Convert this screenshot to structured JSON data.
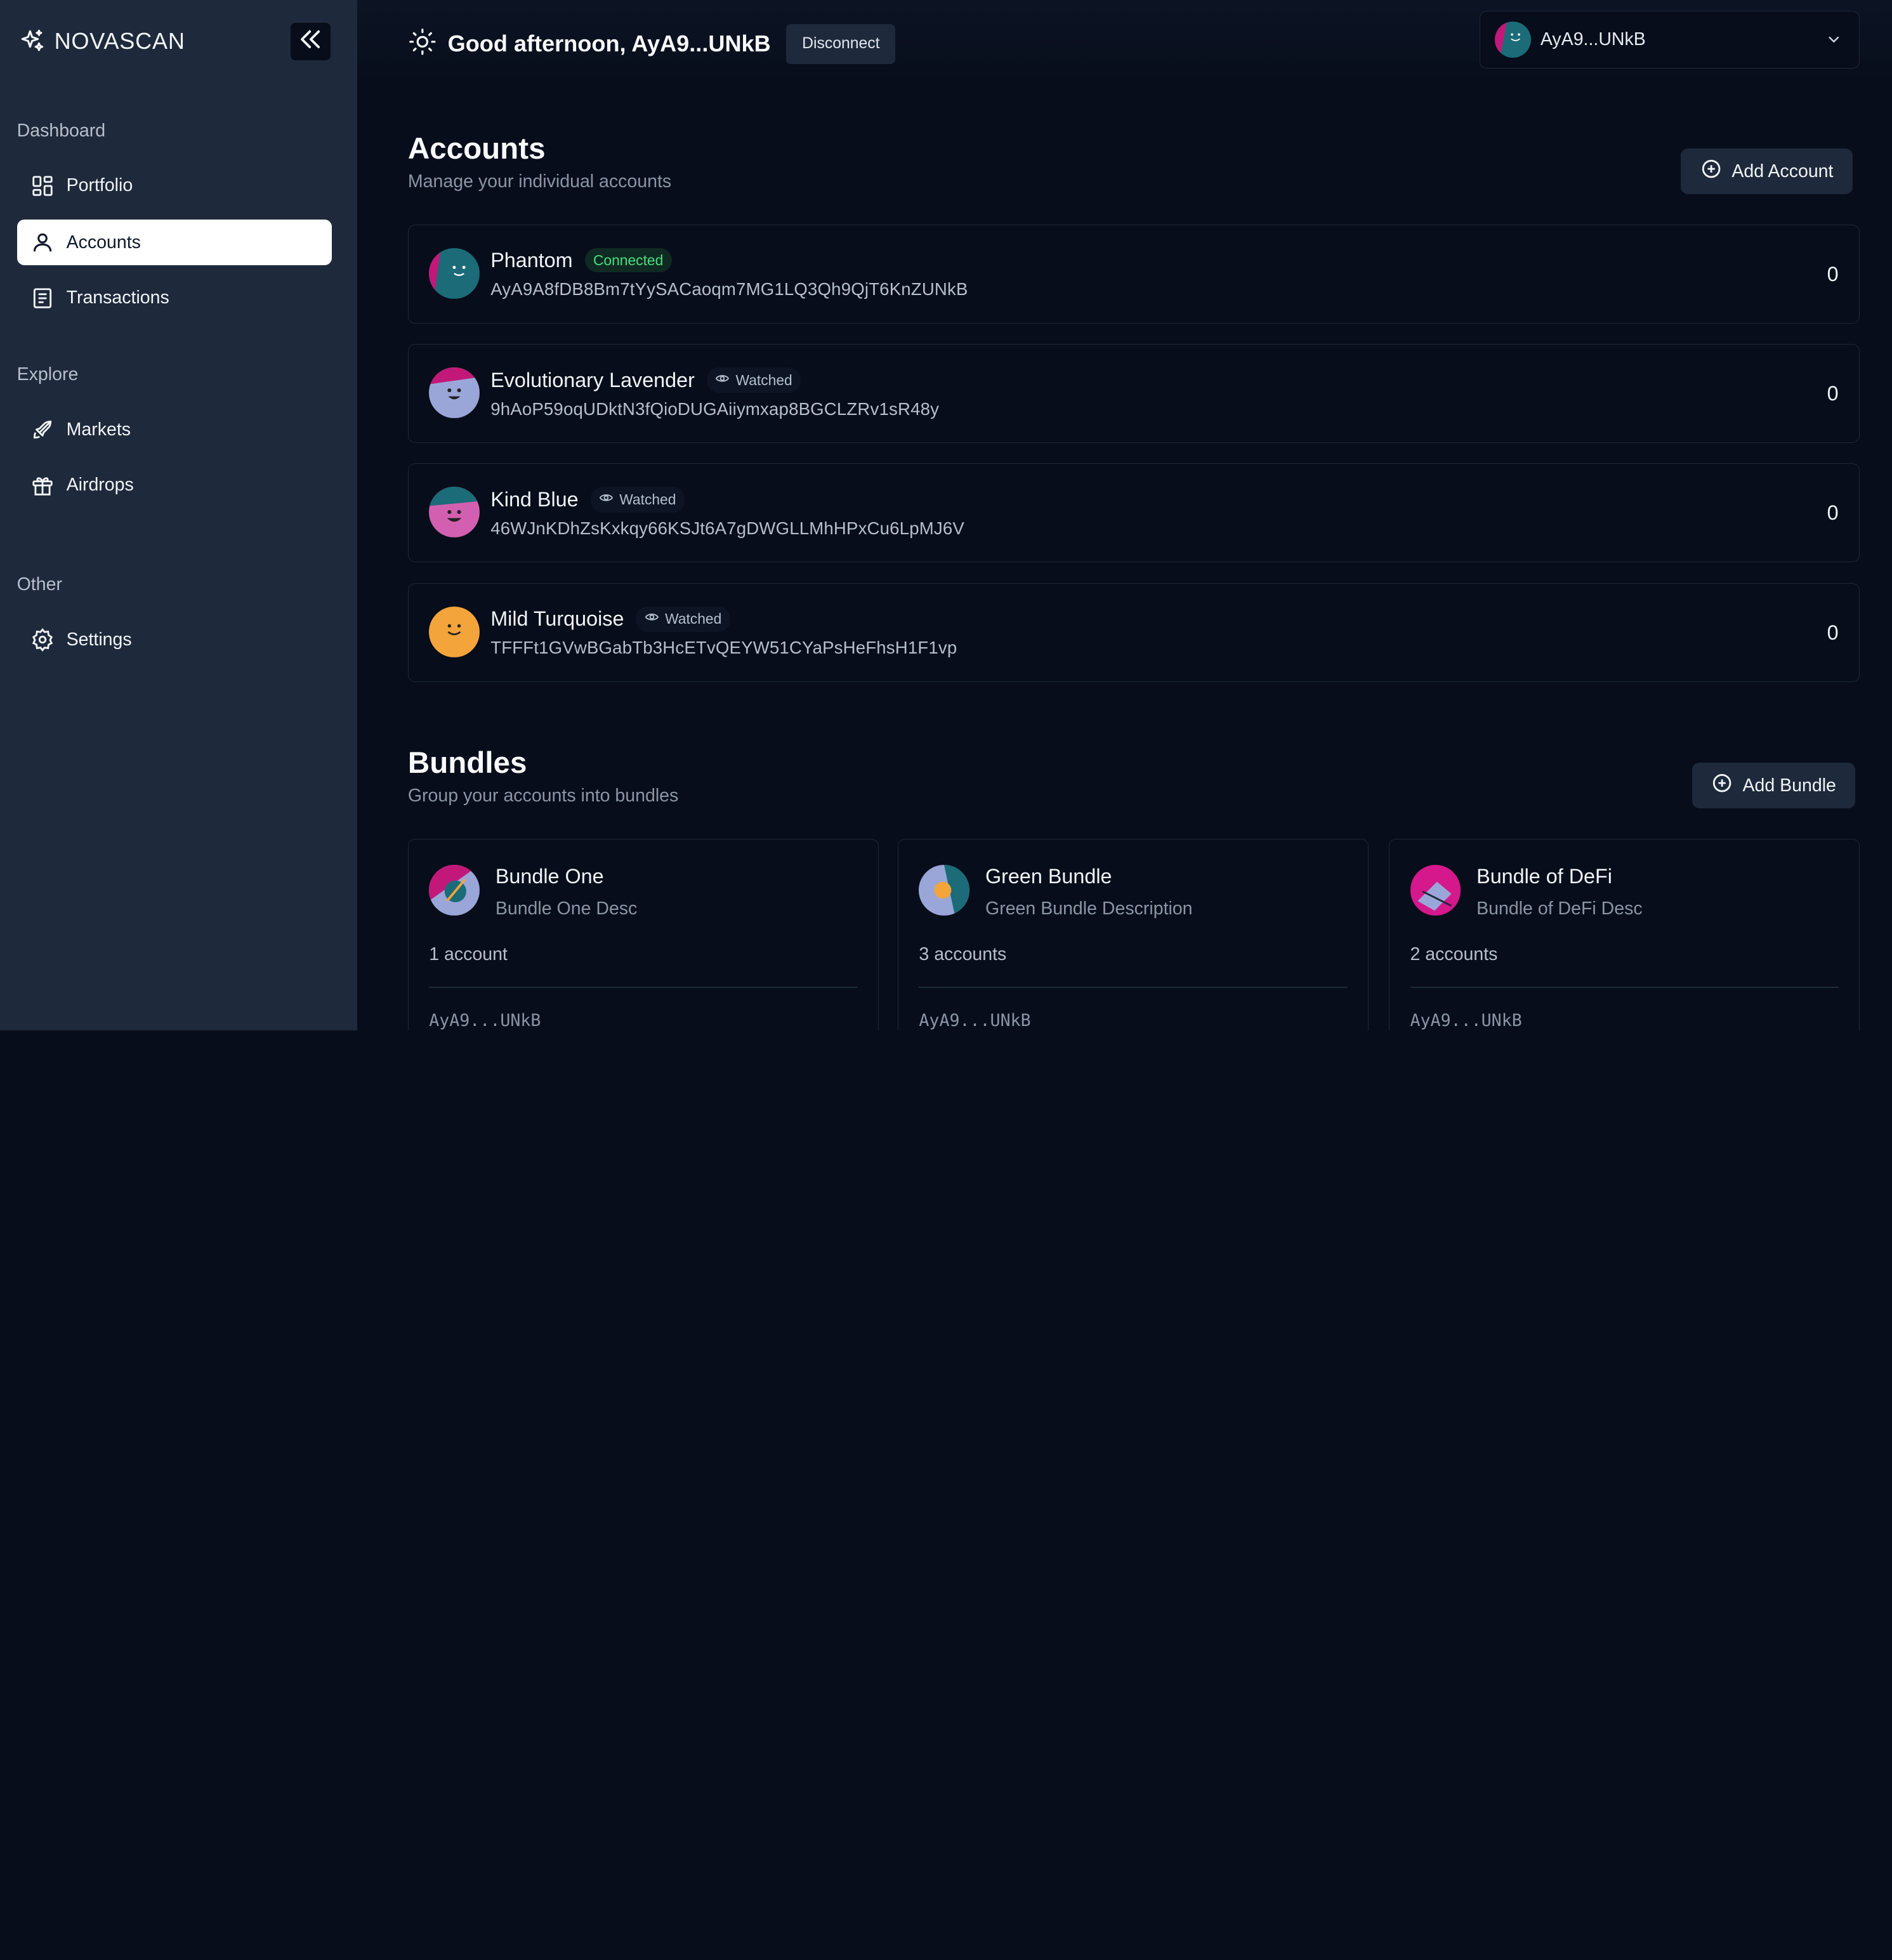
{
  "app": {
    "brand": "NOVASCAN"
  },
  "sidebar": {
    "sections": [
      {
        "title": "Dashboard",
        "items": [
          {
            "label": "Portfolio",
            "icon": "grid-icon"
          },
          {
            "label": "Accounts",
            "icon": "user-icon",
            "active": true
          },
          {
            "label": "Transactions",
            "icon": "receipt-icon"
          }
        ]
      },
      {
        "title": "Explore",
        "items": [
          {
            "label": "Markets",
            "icon": "rocket-icon"
          },
          {
            "label": "Airdrops",
            "icon": "gift-icon"
          }
        ]
      },
      {
        "title": "Other",
        "items": [
          {
            "label": "Settings",
            "icon": "gear-icon"
          }
        ]
      }
    ]
  },
  "topbar": {
    "greeting": "Good afternoon, AyA9...UNkB",
    "disconnect_label": "Disconnect",
    "wallet_label": "AyA9...UNkB"
  },
  "accounts": {
    "title": "Accounts",
    "subtitle": "Manage your individual accounts",
    "add_label": "Add Account",
    "items": [
      {
        "name": "Phantom",
        "status": "Connected",
        "address": "AyA9A8fDB8Bm7tYySACaoqm7MG1LQ3Qh9QjT6KnZUNkB",
        "balance": "0"
      },
      {
        "name": "Evolutionary Lavender",
        "status": "Watched",
        "address": "9hAoP59oqUDktN3fQioDUGAiiymxap8BGCLZRv1sR48y",
        "balance": "0"
      },
      {
        "name": "Kind Blue",
        "status": "Watched",
        "address": "46WJnKDhZsKxkqy66KSJt6A7gDWGLLMhHPxCu6LpMJ6V",
        "balance": "0"
      },
      {
        "name": "Mild Turquoise",
        "status": "Watched",
        "address": "TFFFt1GVwBGabTb3HcETvQEYW51CYaPsHeFhsH1F1vp",
        "balance": "0"
      }
    ]
  },
  "bundles": {
    "title": "Bundles",
    "subtitle": "Group your accounts into bundles",
    "add_label": "Add Bundle",
    "items": [
      {
        "name": "Bundle One",
        "description": "Bundle One Desc",
        "count": "1 account",
        "address": "AyA9...UNkB"
      },
      {
        "name": "Green Bundle",
        "description": "Green Bundle Description",
        "count": "3 accounts",
        "address": "AyA9...UNkB"
      },
      {
        "name": "Bundle of DeFi",
        "description": "Bundle of DeFi Desc",
        "count": "2 accounts",
        "address": "AyA9...UNkB"
      }
    ]
  },
  "colors": {
    "background": "#070d1a",
    "sidebar": "#1e293b",
    "connected": "#4ade80",
    "teal_avatar": "#1b6b78",
    "lavender_avatar": "#9aa6d8",
    "pink_avatar": "#d35fb0",
    "orange_avatar": "#f3a43a",
    "magenta": "#c2187a"
  }
}
